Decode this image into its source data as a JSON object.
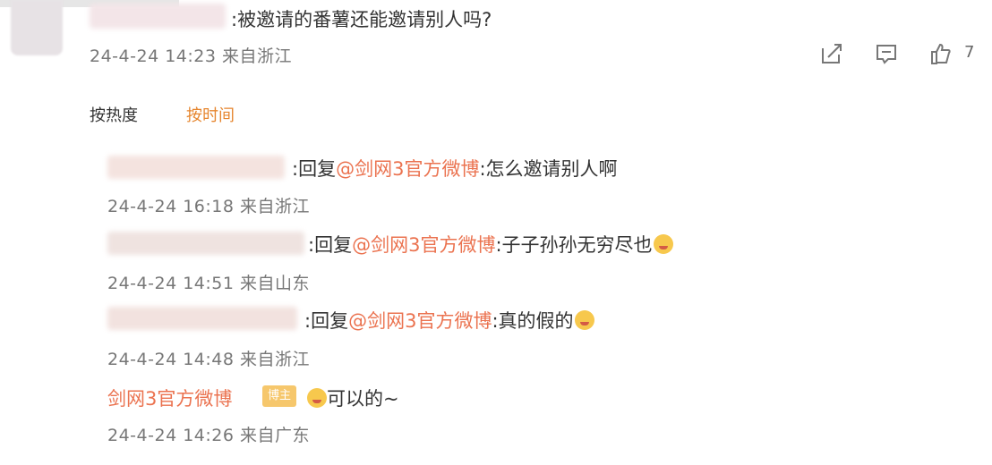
{
  "main_comment": {
    "text": ":被邀请的番薯还能邀请别人吗?",
    "meta": "24-4-24 14:23 来自浙江",
    "like_count": "7"
  },
  "sort": {
    "hot": "按热度",
    "time": "按时间"
  },
  "replies": [
    {
      "text_prefix": ":回复",
      "mention": "@剑网3官方微博",
      "text_suffix": ":怎么邀请别人啊",
      "meta": "24-4-24 16:18 来自浙江"
    },
    {
      "text_prefix": ":回复",
      "mention": "@剑网3官方微博",
      "text_suffix": ":子子孙孙无穷尽也",
      "meta": "24-4-24 14:51 来自山东"
    },
    {
      "text_prefix": ":回复",
      "mention": "@剑网3官方微博",
      "text_suffix": ":真的假的",
      "meta": "24-4-24 14:48 来自浙江"
    },
    {
      "name": "剑网3官方微博",
      "text": "可以的~",
      "meta": "24-4-24 14:26 来自广东"
    }
  ],
  "icons": {
    "share": "share-icon",
    "comment": "comment-icon",
    "like": "thumb-up-icon",
    "emoji": "laugh-emoji-icon"
  },
  "colors": {
    "accent": "#e6862f",
    "mention": "#eb7350",
    "meta": "#777777"
  }
}
